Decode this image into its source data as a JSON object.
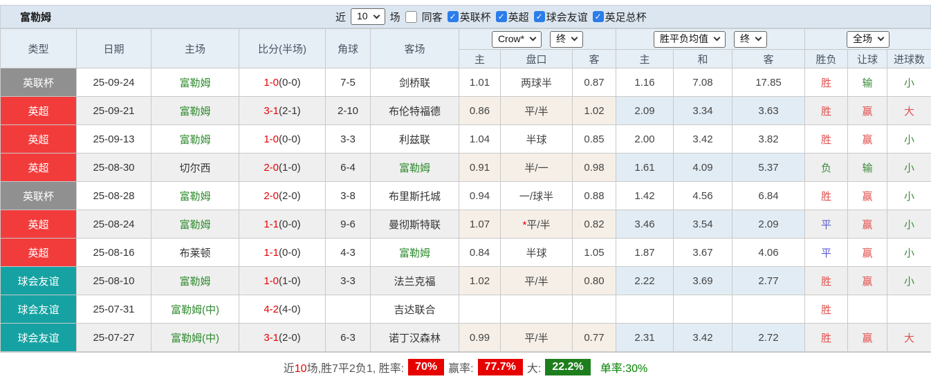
{
  "topbar": {
    "title": "富勒姆",
    "recent_label": "近",
    "recent_value": "10",
    "matches_label": "场",
    "same_venue_label": "同客",
    "leagues": [
      {
        "label": "英联杯",
        "checked": true
      },
      {
        "label": "英超",
        "checked": true
      },
      {
        "label": "球会友谊",
        "checked": true
      },
      {
        "label": "英足总杯",
        "checked": true
      }
    ]
  },
  "header": {
    "type": "类型",
    "date": "日期",
    "home": "主场",
    "score": "比分(半场)",
    "corner": "角球",
    "away": "客场",
    "odds_select": "Crow*",
    "odds_period_select": "终",
    "odds_sub": [
      "主",
      "盘口",
      "客"
    ],
    "avg_select": "胜平负均值",
    "avg_period_select": "终",
    "avg_sub": [
      "主",
      "和",
      "客"
    ],
    "result_select": "全场",
    "result_sub": [
      "胜负",
      "让球",
      "进球数"
    ]
  },
  "rows": [
    {
      "type": "英联杯",
      "type_color": "gray",
      "date": "25-09-24",
      "home": "富勒姆",
      "home_color": "green",
      "score": "1-0",
      "half": "(0-0)",
      "corner": "7-5",
      "away": "剑桥联",
      "away_color": "dark",
      "hc_home": "1.01",
      "hc_star": "",
      "hc_line": "两球半",
      "hc_away": "0.87",
      "avg_home": "1.16",
      "avg_draw": "7.08",
      "avg_away": "17.85",
      "wdl": "胜",
      "wdl_color": "red",
      "hc_res": "输",
      "hc_res_color": "green",
      "goal_res": "小",
      "goal_res_color": "green"
    },
    {
      "type": "英超",
      "type_color": "red",
      "date": "25-09-21",
      "home": "富勒姆",
      "home_color": "green",
      "score": "3-1",
      "half": "(2-1)",
      "corner": "2-10",
      "away": "布伦特福德",
      "away_color": "dark",
      "hc_home": "0.86",
      "hc_star": "",
      "hc_line": "平/半",
      "hc_away": "1.02",
      "avg_home": "2.09",
      "avg_draw": "3.34",
      "avg_away": "3.63",
      "wdl": "胜",
      "wdl_color": "red",
      "hc_res": "赢",
      "hc_res_color": "red",
      "goal_res": "大",
      "goal_res_color": "red"
    },
    {
      "type": "英超",
      "type_color": "red",
      "date": "25-09-13",
      "home": "富勒姆",
      "home_color": "green",
      "score": "1-0",
      "half": "(0-0)",
      "corner": "3-3",
      "away": "利兹联",
      "away_color": "dark",
      "hc_home": "1.04",
      "hc_star": "",
      "hc_line": "半球",
      "hc_away": "0.85",
      "avg_home": "2.00",
      "avg_draw": "3.42",
      "avg_away": "3.82",
      "wdl": "胜",
      "wdl_color": "red",
      "hc_res": "赢",
      "hc_res_color": "red",
      "goal_res": "小",
      "goal_res_color": "green"
    },
    {
      "type": "英超",
      "type_color": "red",
      "date": "25-08-30",
      "home": "切尔西",
      "home_color": "dark",
      "score": "2-0",
      "half": "(1-0)",
      "corner": "6-4",
      "away": "富勒姆",
      "away_color": "green",
      "hc_home": "0.91",
      "hc_star": "",
      "hc_line": "半/一",
      "hc_away": "0.98",
      "avg_home": "1.61",
      "avg_draw": "4.09",
      "avg_away": "5.37",
      "wdl": "负",
      "wdl_color": "green",
      "hc_res": "输",
      "hc_res_color": "green",
      "goal_res": "小",
      "goal_res_color": "green"
    },
    {
      "type": "英联杯",
      "type_color": "gray",
      "date": "25-08-28",
      "home": "富勒姆",
      "home_color": "green",
      "score": "2-0",
      "half": "(2-0)",
      "corner": "3-8",
      "away": "布里斯托城",
      "away_color": "dark",
      "hc_home": "0.94",
      "hc_star": "",
      "hc_line": "一/球半",
      "hc_away": "0.88",
      "avg_home": "1.42",
      "avg_draw": "4.56",
      "avg_away": "6.84",
      "wdl": "胜",
      "wdl_color": "red",
      "hc_res": "赢",
      "hc_res_color": "red",
      "goal_res": "小",
      "goal_res_color": "green"
    },
    {
      "type": "英超",
      "type_color": "red",
      "date": "25-08-24",
      "home": "富勒姆",
      "home_color": "green",
      "score": "1-1",
      "half": "(0-0)",
      "corner": "9-6",
      "away": "曼彻斯特联",
      "away_color": "dark",
      "hc_home": "1.07",
      "hc_star": "*",
      "hc_line": "平/半",
      "hc_away": "0.82",
      "avg_home": "3.46",
      "avg_draw": "3.54",
      "avg_away": "2.09",
      "wdl": "平",
      "wdl_color": "blue",
      "hc_res": "赢",
      "hc_res_color": "red",
      "goal_res": "小",
      "goal_res_color": "green"
    },
    {
      "type": "英超",
      "type_color": "red",
      "date": "25-08-16",
      "home": "布莱顿",
      "home_color": "dark",
      "score": "1-1",
      "half": "(0-0)",
      "corner": "4-3",
      "away": "富勒姆",
      "away_color": "green",
      "hc_home": "0.84",
      "hc_star": "",
      "hc_line": "半球",
      "hc_away": "1.05",
      "avg_home": "1.87",
      "avg_draw": "3.67",
      "avg_away": "4.06",
      "wdl": "平",
      "wdl_color": "blue",
      "hc_res": "赢",
      "hc_res_color": "red",
      "goal_res": "小",
      "goal_res_color": "green"
    },
    {
      "type": "球会友谊",
      "type_color": "teal",
      "date": "25-08-10",
      "home": "富勒姆",
      "home_color": "green",
      "score": "1-0",
      "half": "(1-0)",
      "corner": "3-3",
      "away": "法兰克福",
      "away_color": "dark",
      "hc_home": "1.02",
      "hc_star": "",
      "hc_line": "平/半",
      "hc_away": "0.80",
      "avg_home": "2.22",
      "avg_draw": "3.69",
      "avg_away": "2.77",
      "wdl": "胜",
      "wdl_color": "red",
      "hc_res": "赢",
      "hc_res_color": "red",
      "goal_res": "小",
      "goal_res_color": "green"
    },
    {
      "type": "球会友谊",
      "type_color": "teal",
      "date": "25-07-31",
      "home": "富勒姆(中)",
      "home_color": "green",
      "score": "4-2",
      "half": "(4-0)",
      "corner": "",
      "away": "吉达联合",
      "away_color": "dark",
      "hc_home": "",
      "hc_star": "",
      "hc_line": "",
      "hc_away": "",
      "avg_home": "",
      "avg_draw": "",
      "avg_away": "",
      "wdl": "胜",
      "wdl_color": "red",
      "hc_res": "",
      "hc_res_color": "",
      "goal_res": "",
      "goal_res_color": ""
    },
    {
      "type": "球会友谊",
      "type_color": "teal",
      "date": "25-07-27",
      "home": "富勒姆(中)",
      "home_color": "green",
      "score": "3-1",
      "half": "(2-0)",
      "corner": "6-3",
      "away": "诺丁汉森林",
      "away_color": "dark",
      "hc_home": "0.99",
      "hc_star": "",
      "hc_line": "平/半",
      "hc_away": "0.77",
      "avg_home": "2.31",
      "avg_draw": "3.42",
      "avg_away": "2.72",
      "wdl": "胜",
      "wdl_color": "red",
      "hc_res": "赢",
      "hc_res_color": "red",
      "goal_res": "大",
      "goal_res_color": "red"
    }
  ],
  "summary": {
    "t1": "近",
    "n1": "10",
    "t2": "场,胜7平2负1, 胜率:",
    "win_rate": "70%",
    "t3": "赢率:",
    "asian_rate": "77.7%",
    "t4": "大:",
    "big_rate": "22.2%",
    "t5": "单率:",
    "single_rate": "30%"
  },
  "colors": {
    "league_cup_badge": "#909090",
    "league_epl_badge": "#f23c3c",
    "league_friendly_badge": "#16a2a2",
    "win_text": "#e0504e",
    "lose_text": "#3d8b3d",
    "draw_text": "#5a5ad2",
    "score_text": "#e60000",
    "fulham_team_text": "#2e8b2e",
    "rate_badge_red": "#e60000",
    "rate_badge_green": "#1e7e1e",
    "checkbox_checked": "#2b7de9",
    "header_bg": "#e6eef6",
    "topbar_bg": "#dce6f0"
  }
}
